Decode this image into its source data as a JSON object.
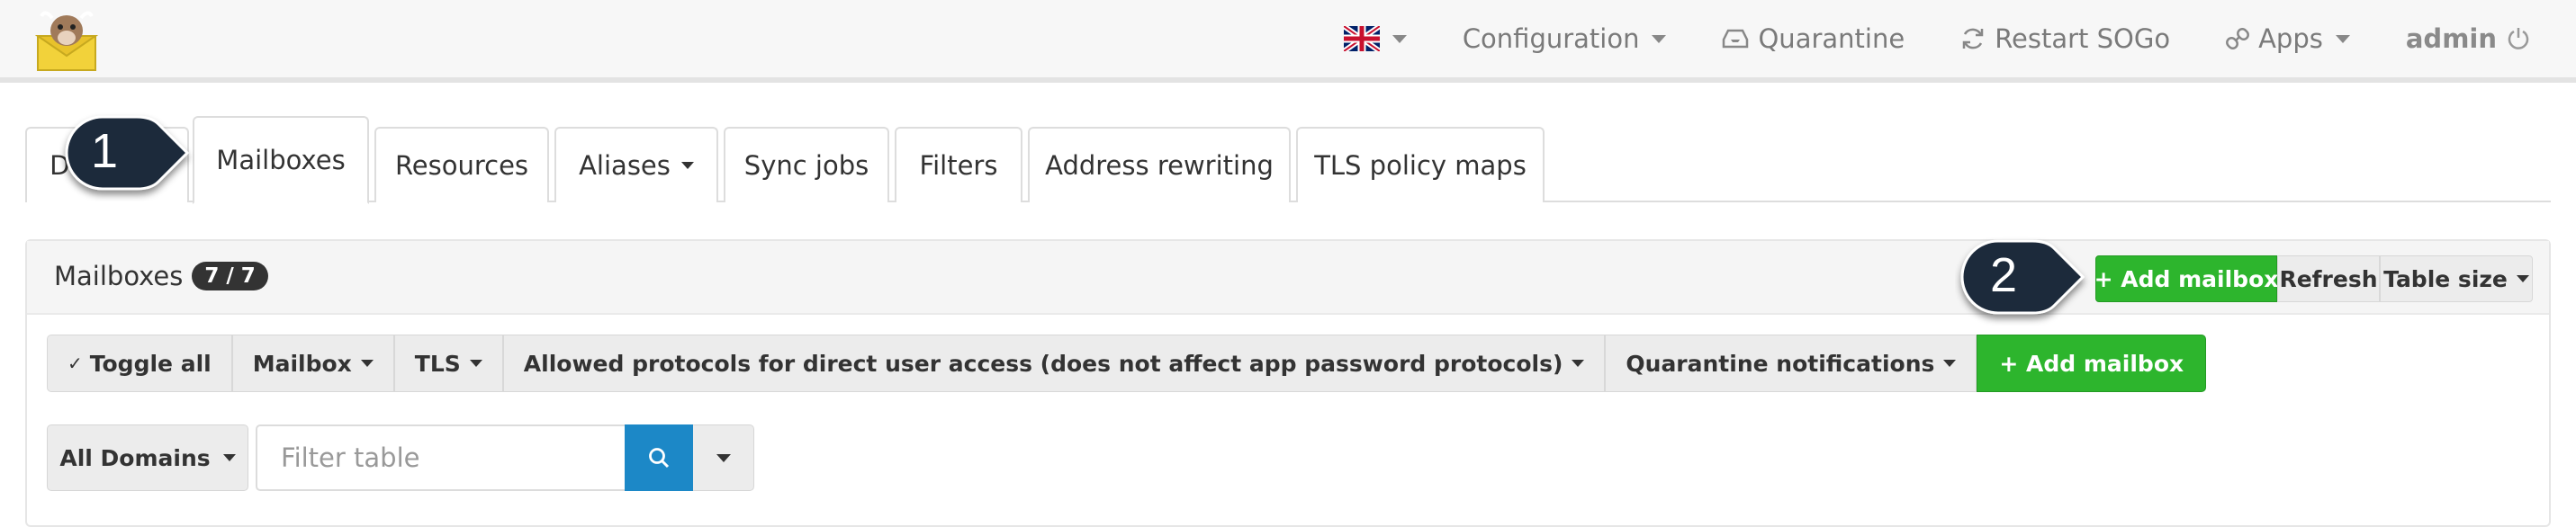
{
  "navbar": {
    "language_flag": "uk-flag-icon",
    "items": [
      {
        "label": "Configuration",
        "icon": ""
      },
      {
        "label": "Quarantine",
        "icon": "inbox-icon"
      },
      {
        "label": "Restart SOGo",
        "icon": "refresh-icon"
      },
      {
        "label": "Apps",
        "icon": "link-icon"
      },
      {
        "label": "admin",
        "icon": "power-icon"
      }
    ]
  },
  "tabs": [
    {
      "label": "Domains"
    },
    {
      "label": "Mailboxes",
      "active": true
    },
    {
      "label": "Resources"
    },
    {
      "label": "Aliases"
    },
    {
      "label": "Sync jobs"
    },
    {
      "label": "Filters"
    },
    {
      "label": "Address rewriting"
    },
    {
      "label": "TLS policy maps"
    }
  ],
  "callouts": [
    "1",
    "2"
  ],
  "panel": {
    "title": "Mailboxes",
    "badge": "7 / 7",
    "header_buttons": {
      "add": "+ Add mailbox",
      "refresh": "Refresh",
      "table_size": "Table size"
    },
    "toolbar": {
      "toggle_all": "Toggle all",
      "mailbox": "Mailbox",
      "tls": "TLS",
      "protocols": "Allowed protocols for direct user access (does not affect app password protocols)",
      "quarantine": "Quarantine notifications",
      "add": "+ Add mailbox"
    },
    "filter": {
      "domains": "All Domains",
      "placeholder": "Filter table"
    }
  },
  "colors": {
    "green": "#2db52d",
    "blue": "#1c88c7",
    "callout": "#1e2a3a"
  }
}
